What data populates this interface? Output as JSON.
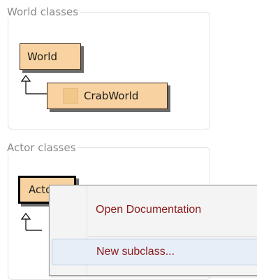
{
  "world_panel": {
    "title": "World classes",
    "classes": [
      {
        "name": "World"
      },
      {
        "name": "CrabWorld",
        "icon": "crab-world-image-icon"
      }
    ]
  },
  "actor_panel": {
    "title": "Actor classes",
    "classes": [
      {
        "name": "Actor",
        "selected": true
      }
    ]
  },
  "context_menu": {
    "items": [
      {
        "label": "Open Documentation"
      },
      {
        "label": "New subclass...",
        "highlighted": true
      }
    ]
  },
  "colors": {
    "class_fill": "#f8d2a0",
    "menu_text": "#8b1a1a",
    "menu_highlight": "#e7eef7",
    "panel_border": "#e3e3e3",
    "panel_title": "#8a8a8a"
  }
}
